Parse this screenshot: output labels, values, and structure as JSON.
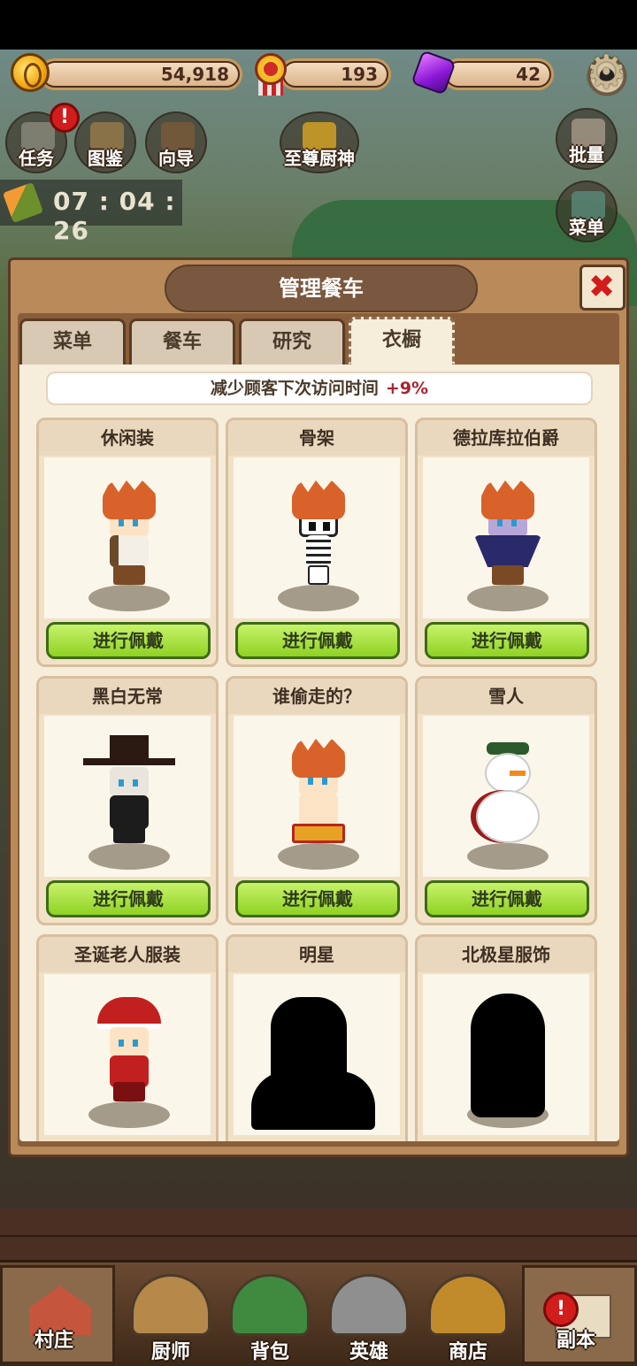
{
  "currency": {
    "gold": "54,918",
    "medals": "193",
    "gems": "42"
  },
  "top_buttons": {
    "tasks": "任务",
    "atlas": "图鉴",
    "guide": "向导",
    "supreme_chef": "至尊厨神",
    "batch": "批量",
    "menu": "菜单",
    "tasks_badge": "!"
  },
  "timer": "07 : 04 : 26",
  "panel": {
    "title": "管理餐车",
    "tabs": [
      "菜单",
      "餐车",
      "研究",
      "衣橱"
    ],
    "active_tab": 3,
    "bonus_text": "减少顾客下次访问时间",
    "bonus_value": "+9%"
  },
  "costumes": [
    {
      "name": "休闲装",
      "button": "进行佩戴"
    },
    {
      "name": "骨架",
      "button": "进行佩戴"
    },
    {
      "name": "德拉库拉伯爵",
      "button": "进行佩戴"
    },
    {
      "name": "黑白无常",
      "button": "进行佩戴"
    },
    {
      "name": "谁偷走的？",
      "button": "进行佩戴"
    },
    {
      "name": "雪人",
      "button": "进行佩戴"
    },
    {
      "name": "圣诞老人服装",
      "button": ""
    },
    {
      "name": "明星",
      "button": ""
    },
    {
      "name": "北极星服饰",
      "button": ""
    }
  ],
  "nav": {
    "village": "村庄",
    "chef": "厨师",
    "bag": "背包",
    "heroes": "英雄",
    "shop": "商店",
    "dungeon": "副本",
    "dungeon_badge": "!"
  },
  "colors": {
    "wear_button": "#8fd223",
    "bonus_value": "#a8232f",
    "close_x": "#d21b1b"
  }
}
